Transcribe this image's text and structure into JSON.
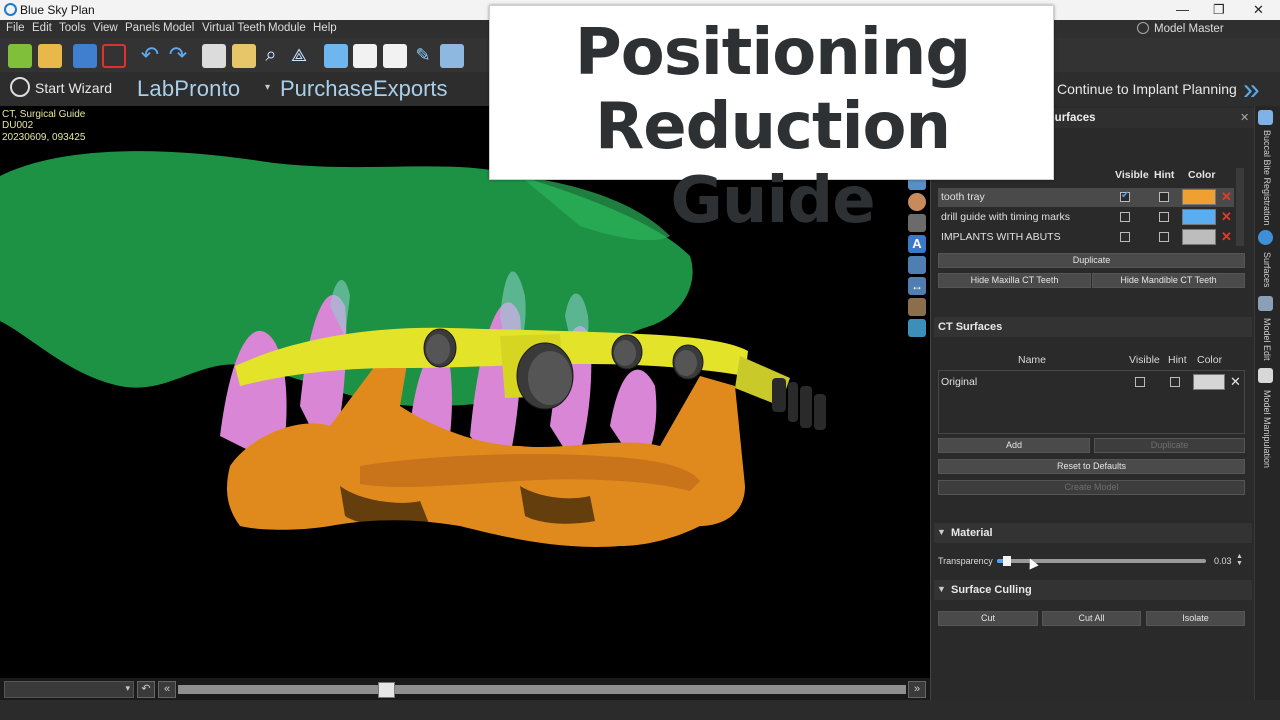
{
  "window": {
    "title": "Blue Sky Plan",
    "controls": [
      "—",
      "❐",
      "✕"
    ]
  },
  "menu": [
    "File",
    "Edit",
    "Tools",
    "View",
    "Panels",
    "Model",
    "Virtual Teeth",
    "Module",
    "Help"
  ],
  "model_master": "Model Master",
  "wizard": {
    "start": "Start Wizard",
    "labpronto": "LabPronto",
    "purchase": "PurchaseExports",
    "continue": "Continue to Implant Planning"
  },
  "viewport_info": {
    "line1": "CT, Surgical Guide",
    "line2": "DU002",
    "line3": "20230609, 093425"
  },
  "overlay": {
    "line1": "Positioning",
    "line2": "Reduction Guide"
  },
  "panel": {
    "title": "Surfaces",
    "model_table": {
      "headers": {
        "visible": "Visible",
        "hint": "Hint",
        "color": "Color"
      },
      "rows": [
        {
          "name": "tooth tray",
          "visible": true,
          "hint": false,
          "color": "#f0a030"
        },
        {
          "name": "drill guide with timing marks",
          "visible": false,
          "hint": false,
          "color": "#5aaef0"
        },
        {
          "name": "IMPLANTS WITH ABUTS",
          "visible": false,
          "hint": false,
          "color": "#bdbdbd"
        }
      ]
    },
    "duplicate": "Duplicate",
    "hide_maxilla": "Hide Maxilla CT Teeth",
    "hide_mandible": "Hide Mandible CT Teeth",
    "ct": {
      "title": "CT Surfaces",
      "headers": {
        "name": "Name",
        "visible": "Visible",
        "hint": "Hint",
        "color": "Color"
      },
      "rows": [
        {
          "name": "Original",
          "visible": false,
          "hint": false,
          "color": "#d6d6d6"
        }
      ],
      "add": "Add",
      "duplicate": "Duplicate",
      "reset": "Reset to Defaults",
      "create_model": "Create Model"
    },
    "material": {
      "title": "Material",
      "transparency_label": "Transparency",
      "transparency_value": "0.03",
      "transparency_level": 0.03
    },
    "culling": {
      "title": "Surface Culling",
      "cut": "Cut",
      "cut_all": "Cut All",
      "isolate": "Isolate"
    }
  },
  "vertical_tabs": [
    "Buccal Bite Registration",
    "Surfaces",
    "Model Edit",
    "Model Manipulation"
  ],
  "scrub": {
    "position": 0.275
  },
  "colors": {
    "accent": "#4aa3ff",
    "guide_green": "#1f9e4a",
    "tray_orange": "#e08a1e",
    "drill_yellow": "#e3e32a",
    "teeth_pink": "#d986d6"
  }
}
